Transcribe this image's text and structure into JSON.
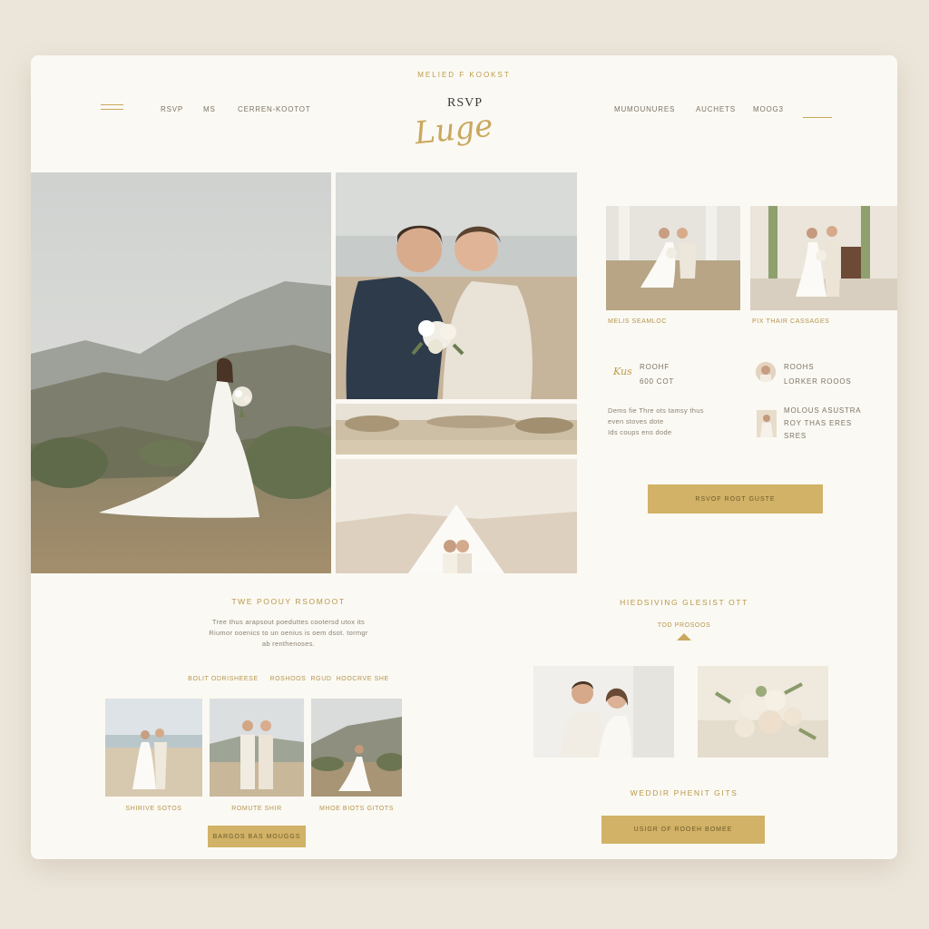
{
  "header": {
    "tagline": "MELIED F KOOKST",
    "logo_top": "RSVP",
    "logo_script": "Luge",
    "nav_left": [
      "RSVP",
      "MS",
      "CERREN-KOOTOT"
    ],
    "nav_right": [
      "MUMOUNURES",
      "AUCHETS",
      "MOOG3"
    ]
  },
  "gallery": {
    "cap_left": "MELIS SEAMLOC",
    "cap_right": "PIX THAIR CASSAGES"
  },
  "info": {
    "script_word": "Kus",
    "label_line1": "ROOHF",
    "label_line2": "600 COT",
    "desc_lines": [
      "Dems fie Thre ots tamsy thus",
      "even stoves dote",
      "Ids coups ens dode"
    ],
    "side1_line1": "ROOHS",
    "side1_line2": "LORKER ROOOS",
    "side2_line1": "MOLOUS ASUSTRA",
    "side2_line2": "ROY THAS ERES",
    "side2_line3": "SRES",
    "rsvp_button": "RSVOF ROGT GUSTE"
  },
  "story": {
    "heading": "TWE POOUY RSOMOOT",
    "body": [
      "Tree thus arapsout poeduttes cootersd utox its",
      "Riumor ooenics to un oenius is oem dsot. tormgr",
      "ab renthenoses."
    ],
    "links": "BOLIT ODRISHEESE     ROSHOOS  RGUD  HOOCRVE SHE",
    "captions": [
      "SHIRIVE SOTOS",
      "ROMUTE SHIR",
      "MHOE BIOTS GITOTS"
    ],
    "button": "BARGOS BAS MOUGGS"
  },
  "registry": {
    "heading": "HIEDSIVING GLESIST OTT",
    "subheading": "TOD PROSOOS",
    "gifts_heading": "WEDDIR PHENIT GITS",
    "button": "USIGR  OF ROOEH BOMEE"
  },
  "colors": {
    "background": "#ece6da",
    "card": "#fbf9f3",
    "accent": "#d1b266",
    "accent_text": "#bf9a4a"
  }
}
